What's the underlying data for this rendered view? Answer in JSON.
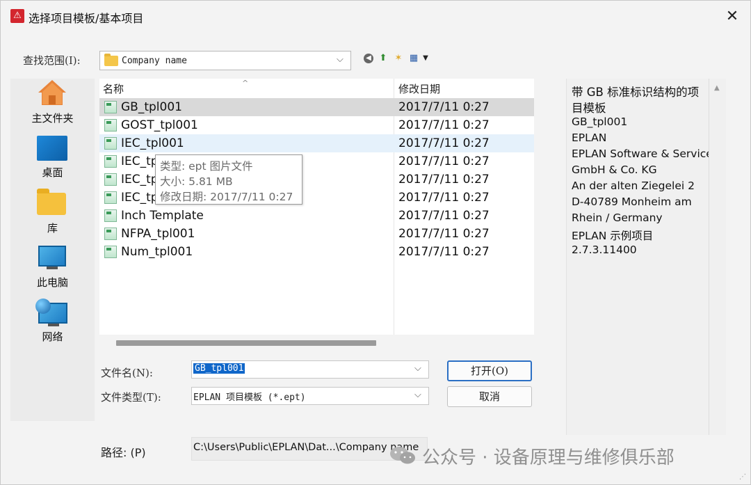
{
  "window": {
    "title": "选择项目模板/基本项目",
    "close": "✕",
    "app_icon": "⚠"
  },
  "lookin": {
    "label": "查找范围(I):",
    "value": "Company name",
    "arrow": "⌵"
  },
  "toolbar": {
    "back": "◀",
    "up": "⬆",
    "new_folder": "✶",
    "view": "▦",
    "view_menu": "▼"
  },
  "places": [
    {
      "label": "主文件夹",
      "icon": "home-icon"
    },
    {
      "label": "桌面",
      "icon": "desktop-icon"
    },
    {
      "label": "库",
      "icon": "library-folder-icon"
    },
    {
      "label": "此电脑",
      "icon": "computer-icon"
    },
    {
      "label": "网络",
      "icon": "network-icon"
    }
  ],
  "filelist": {
    "columns": {
      "name": "名称",
      "date": "修改日期",
      "sort_caret": "^"
    },
    "files": [
      {
        "name": "GB_tpl001",
        "date": "2017/7/11 0:27"
      },
      {
        "name": "GOST_tpl001",
        "date": "2017/7/11 0:27"
      },
      {
        "name": "IEC_tpl001",
        "date": "2017/7/11 0:27"
      },
      {
        "name": "IEC_tp",
        "date": "2017/7/11 0:27"
      },
      {
        "name": "IEC_tp",
        "date": "2017/7/11 0:27"
      },
      {
        "name": "IEC_tp",
        "date": "2017/7/11 0:27"
      },
      {
        "name": "Inch Template",
        "date": "2017/7/11 0:27"
      },
      {
        "name": "NFPA_tpl001",
        "date": "2017/7/11 0:27"
      },
      {
        "name": "Num_tpl001",
        "date": "2017/7/11 0:27"
      }
    ]
  },
  "tooltip": {
    "type": "类型: ept 图片文件",
    "size": "大小: 5.81 MB",
    "modified": "修改日期: 2017/7/11 0:27"
  },
  "filename": {
    "label": "文件名(N):",
    "value": "GB_tpl001",
    "arrow": "⌵"
  },
  "filetype": {
    "label": "文件类型(T):",
    "value": "EPLAN 项目模板 (*.ept)",
    "arrow": "⌵"
  },
  "buttons": {
    "open": "打开(O)",
    "cancel": "取消"
  },
  "path": {
    "label": "路径: (P)",
    "value": "C:\\Users\\Public\\EPLAN\\Dat...\\Company name"
  },
  "preview": {
    "lines": [
      "带 GB 标准标识结构的项",
      "目模板",
      "GB_tpl001",
      "EPLAN",
      "EPLAN Software & Service",
      "GmbH & Co. KG",
      "An der alten Ziegelei 2",
      "D-40789 Monheim am",
      "Rhein / Germany",
      "EPLAN 示例项目",
      "2.7.3.11400"
    ],
    "scroll_up": "▲"
  },
  "watermark": {
    "text": "公众号 · 设备原理与维修俱乐部"
  },
  "colors": {
    "accent": "#0f66c9",
    "selected_row": "#d9d9d9",
    "hover_row": "#e5f1fb",
    "app_icon": "#d3262e"
  }
}
